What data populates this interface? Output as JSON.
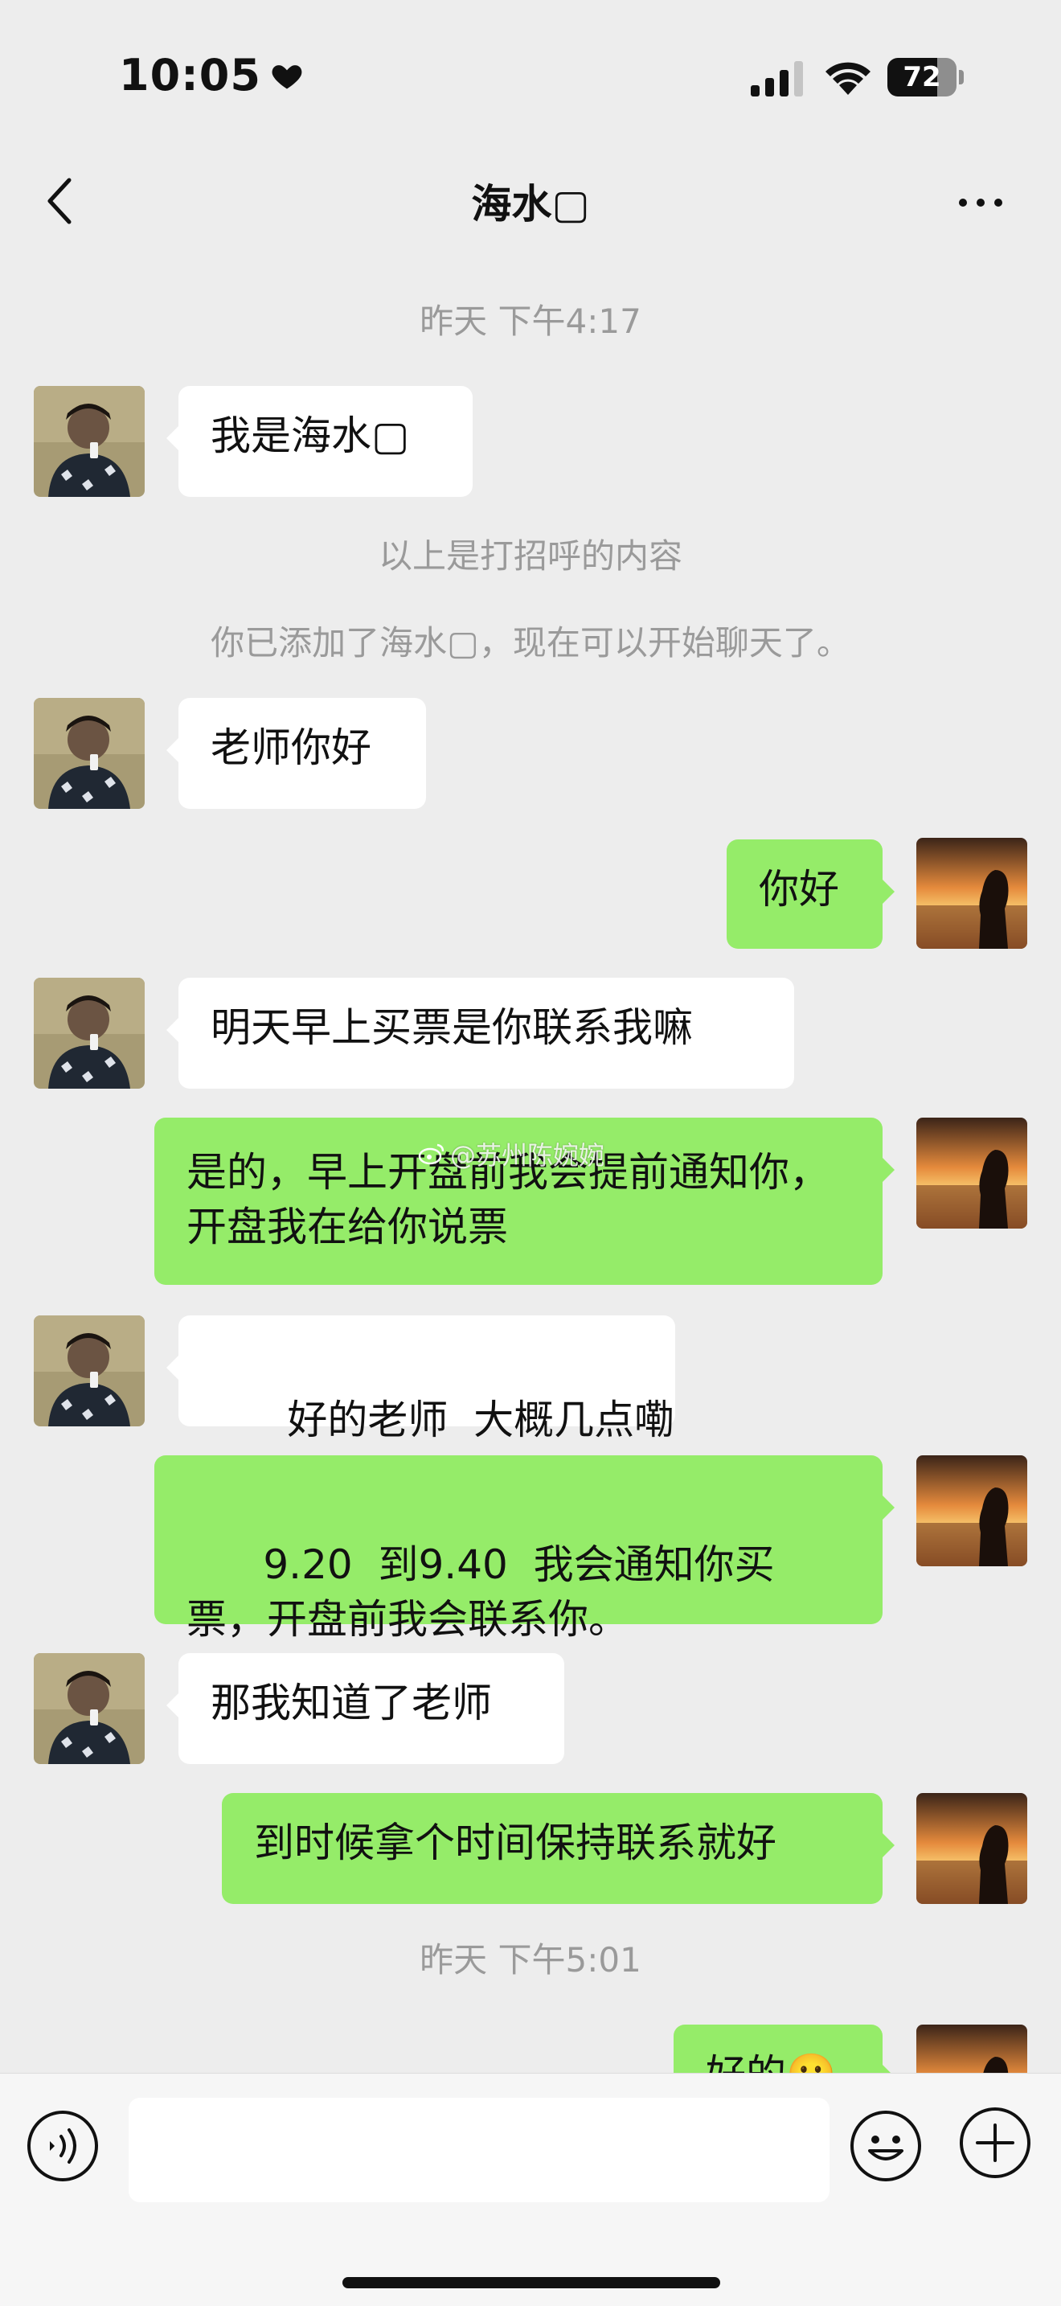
{
  "status_bar": {
    "time": "10:05",
    "battery": "72",
    "battery_level": 0.72
  },
  "header": {
    "title": "海水▢"
  },
  "messages": [
    {
      "kind": "time",
      "text": "昨天 下午4:17"
    },
    {
      "kind": "incoming",
      "text": "我是海水▢"
    },
    {
      "kind": "system",
      "text": "以上是打招呼的内容"
    },
    {
      "kind": "system",
      "text": "你已添加了海水▢，现在可以开始聊天了。"
    },
    {
      "kind": "incoming",
      "text": "老师你好"
    },
    {
      "kind": "outgoing",
      "text": "你好"
    },
    {
      "kind": "incoming",
      "text": "明天早上买票是你联系我嘛"
    },
    {
      "kind": "outgoing",
      "text": "是的，早上开盘前我会提前通知你，开盘我在给你说票"
    },
    {
      "kind": "incoming",
      "text": "好的老师  大概几点嘞"
    },
    {
      "kind": "outgoing",
      "text": "9.20  到9.40  我会通知你买票，开盘前我会联系你。"
    },
    {
      "kind": "incoming",
      "text": "那我知道了老师"
    },
    {
      "kind": "outgoing",
      "text": "到时候拿个时间保持联系就好"
    },
    {
      "kind": "time",
      "text": "昨天 下午5:01"
    },
    {
      "kind": "outgoing",
      "text": "好的🙂"
    }
  ],
  "watermark": {
    "text": "@苏州陈婉婉"
  },
  "input": {
    "value": ""
  },
  "colors": {
    "outgoing_bubble": "#95ec69",
    "incoming_bubble": "#ffffff",
    "background": "#ededed"
  }
}
